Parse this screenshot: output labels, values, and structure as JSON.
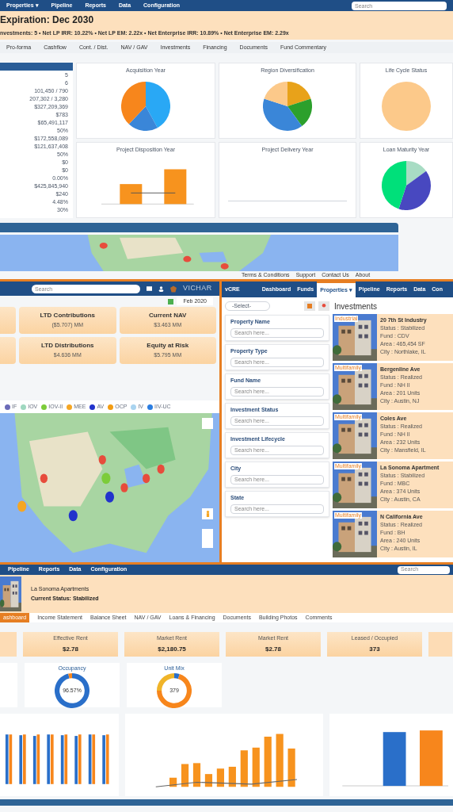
{
  "fund_screen": {
    "nav": [
      "Properties ▾",
      "Pipeline",
      "Reports",
      "Data",
      "Configuration"
    ],
    "search": {
      "placeholder": "Search"
    },
    "title": "Expiration: Dec 2030",
    "summary": "nvestments: 5 • Net LP IRR: 10.22% • Net LP EM: 2.22x • Net Enterprise IRR: 10.89% • Net Enterprise EM: 2.29x",
    "tabs": [
      "Pro-forma",
      "Cashflow",
      "Cont. / Dist.",
      "NAV / GAV",
      "Investments",
      "Financing",
      "Documents",
      "Fund Commentary"
    ],
    "stats": [
      "5",
      "6",
      "101,450 / 790",
      "207,302 / 3,280",
      "$327,209,369",
      "$783",
      "$65,491,117",
      "50%",
      "$172,558,089",
      "$121,637,408",
      "50%",
      "$0",
      "$0",
      "0.00%",
      "$425,845,940",
      "$240",
      "4.48%",
      "30%"
    ],
    "charts": [
      {
        "title": "Acquisition Year",
        "kind": "pie"
      },
      {
        "title": "Region Diversification",
        "kind": "pie"
      },
      {
        "title": "Life Cycle Status",
        "kind": "pie"
      },
      {
        "title": "Project Disposition Year",
        "kind": "bar"
      },
      {
        "title": "Project Delivery Year",
        "kind": "empty"
      },
      {
        "title": "Loan Maturity Year",
        "kind": "pie"
      }
    ],
    "footer_links": [
      "Terms & Conditions",
      "Support",
      "Contact Us",
      "About"
    ]
  },
  "portfolio_screen": {
    "search": {
      "placeholder": "Search"
    },
    "logo": "VICHAR",
    "date": "Feb 2020",
    "metrics": [
      {
        "label": "LTD Contributions",
        "value": "($5.707) MM"
      },
      {
        "label": "Current NAV",
        "value": "$3.463 MM"
      },
      {
        "label": "LTD Distributions",
        "value": "$4.636 MM"
      },
      {
        "label": "Equity at Risk",
        "value": "$5.795 MM"
      }
    ],
    "legend": [
      {
        "label": "IF",
        "color": "#6b6bb8"
      },
      {
        "label": "IOV",
        "color": "#9fd8c0"
      },
      {
        "label": "IOV-II",
        "color": "#7ccc3a"
      },
      {
        "label": "MEE",
        "color": "#f5a623"
      },
      {
        "label": "AV",
        "color": "#2233cc"
      },
      {
        "label": "OCP",
        "color": "#f39c12"
      },
      {
        "label": "IV",
        "color": "#a9d4f0"
      },
      {
        "label": "IIV-UC",
        "color": "#2a7de1"
      }
    ]
  },
  "investments_screen": {
    "brand": "vCRE",
    "nav": [
      {
        "label": "Dashboard",
        "selected": false
      },
      {
        "label": "Funds",
        "selected": false
      },
      {
        "label": "Properties ▾",
        "selected": true
      },
      {
        "label": "Pipeline",
        "selected": false
      },
      {
        "label": "Reports",
        "selected": false
      },
      {
        "label": "Data",
        "selected": false
      },
      {
        "label": "Con",
        "selected": false
      }
    ],
    "select": "-Select-",
    "heading": "Investments",
    "filters": [
      {
        "label": "Property Name",
        "placeholder": "Search here..."
      },
      {
        "label": "Property Type",
        "placeholder": "Search here..."
      },
      {
        "label": "Fund Name",
        "placeholder": "Search here..."
      },
      {
        "label": "Investment Status",
        "placeholder": "Search here..."
      },
      {
        "label": "Investment Lifecycle",
        "placeholder": "Search here..."
      },
      {
        "label": "City",
        "placeholder": "Search here..."
      },
      {
        "label": "State",
        "placeholder": "Search here..."
      }
    ],
    "properties": [
      {
        "type": "Industrial",
        "name": "20 7th St Industry",
        "lines": [
          "Status : Stabilized",
          "Fund : CDV",
          "Area : 465,454 SF",
          "City : Northlake, IL"
        ]
      },
      {
        "type": "Multifamily",
        "name": "Bergenline Ave",
        "lines": [
          "Status : Realized",
          "Fund : NH II",
          "Area : 201 Units",
          "City : Austin, NJ"
        ]
      },
      {
        "type": "Multifamily",
        "name": "Coles Ave",
        "lines": [
          "Status : Realized",
          "Fund : NH II",
          "Area : 232 Units",
          "City : Mansfield, IL"
        ]
      },
      {
        "type": "Multifamily",
        "name": "La Sonoma Apartment",
        "lines": [
          "Status : Stabilized",
          "Fund : MBC",
          "Area : 374 Units",
          "City : Austin, CA"
        ]
      },
      {
        "type": "Multifamily",
        "name": "N California Ave",
        "lines": [
          "Status : Realized",
          "Fund : BH",
          "Area : 240 Units",
          "City : Austin, IL"
        ]
      }
    ]
  },
  "property_screen": {
    "nav": [
      "Pipeline",
      "Reports",
      "Data",
      "Configuration"
    ],
    "search": {
      "placeholder": "Search"
    },
    "name": "La Sonoma Apartments",
    "status": "Current Status: Stabilized",
    "tabs": [
      {
        "label": "ashboard",
        "selected": true
      },
      {
        "label": "Income Statement",
        "selected": false
      },
      {
        "label": "Balance Sheet",
        "selected": false
      },
      {
        "label": "NAV / GAV",
        "selected": false
      },
      {
        "label": "Loans & Financing",
        "selected": false
      },
      {
        "label": "Documents",
        "selected": false
      },
      {
        "label": "Building Photos",
        "selected": false
      },
      {
        "label": "Comments",
        "selected": false
      }
    ],
    "cards": [
      {
        "label": "Effective Rent",
        "value": "$2.78"
      },
      {
        "label": "Market Rent",
        "value": "$2,180.75"
      },
      {
        "label": "Market Rent",
        "value": "$2.78"
      },
      {
        "label": "Leased / Occupied",
        "value": "373"
      }
    ],
    "donuts": [
      {
        "title": "Occupancy",
        "value": "96.57%"
      },
      {
        "title": "Unit Mix",
        "value": "379"
      }
    ],
    "charts": [
      {
        "kind": "grouped"
      },
      {
        "kind": "combo"
      },
      {
        "kind": "pair"
      }
    ]
  }
}
